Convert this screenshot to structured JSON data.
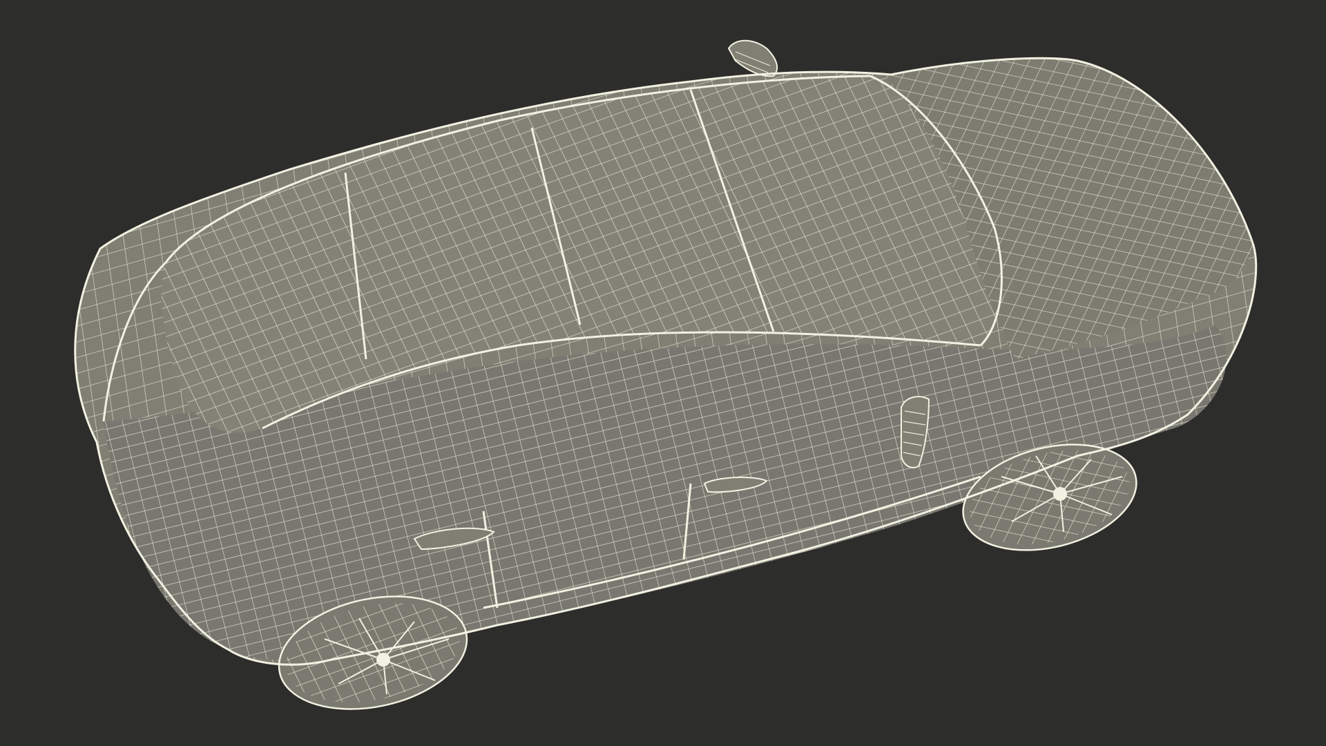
{
  "scene": {
    "subject": "car-wireframe-render",
    "colors": {
      "background": "#2d2d2b",
      "surface": "#7f7f74",
      "surface_dark": "#6c6c62",
      "wire": "#ecebd9",
      "tire": "#3e3e39"
    }
  }
}
